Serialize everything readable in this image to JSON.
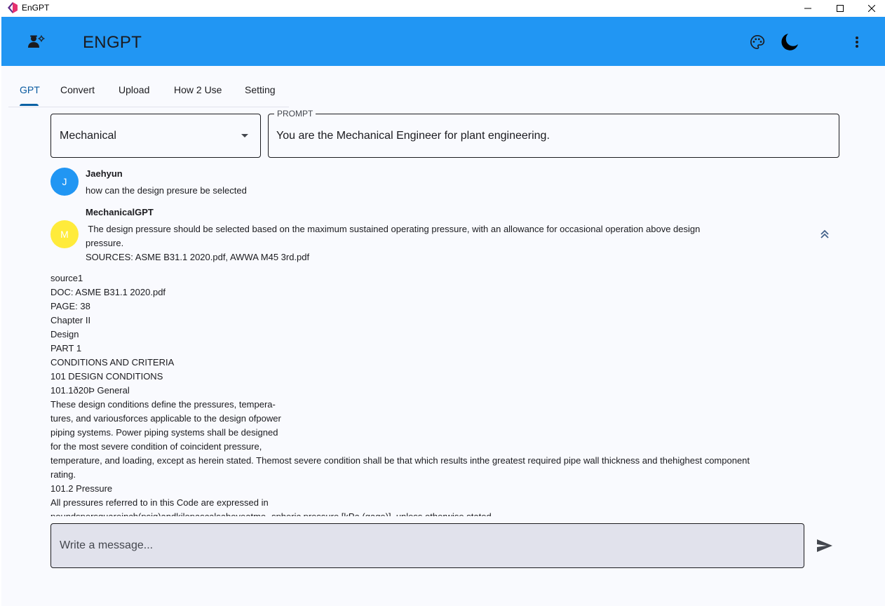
{
  "window": {
    "title": "EnGPT",
    "min_icon": "minimize-icon",
    "max_icon": "maximize-icon",
    "close_icon": "close-icon"
  },
  "appbar": {
    "title": "ENGPT",
    "background": "#2196f3",
    "leading_icon": "engineer-icon",
    "actions": [
      "palette-icon",
      "dark-mode-icon",
      "more-vert-icon"
    ]
  },
  "tabs": [
    {
      "label": "GPT",
      "active": true
    },
    {
      "label": "Convert",
      "active": false
    },
    {
      "label": "Upload",
      "active": false
    },
    {
      "label": "How 2 Use",
      "active": false
    },
    {
      "label": "Setting",
      "active": false
    }
  ],
  "role_select": {
    "value": "Mechanical",
    "icon": "dropdown-arrow-icon"
  },
  "prompt": {
    "label": "PROMPT",
    "value": "You are the Mechanical Engineer for plant engineering."
  },
  "messages": [
    {
      "author": "Jaehyun",
      "avatar_letter": "J",
      "avatar_color": "#2196f3",
      "text": "how can the design presure be selected"
    },
    {
      "author": "MechanicalGPT",
      "avatar_letter": "M",
      "avatar_color": "#ffeb3b",
      "text_line1": " The design pressure should be selected based on the maximum sustained operating pressure, with an allowance for occasional operation above design",
      "text_line2": "pressure.",
      "sources": "SOURCES: ASME B31.1 2020.pdf, AWWA M45 3rd.pdf",
      "collapse_icon": "double-chevron-up-icon"
    }
  ],
  "source_detail": [
    "source1",
    "DOC: ASME B31.1 2020.pdf",
    "PAGE: 38",
    "Chapter II",
    "Design",
    "PART 1",
    "CONDITIONS AND CRITERIA",
    "101 DESIGN CONDITIONS",
    "101.1ð20Þ General",
    "These design conditions define the pressures, tempera-",
    "tures, and variousforces applicable to the design ofpower",
    "piping systems. Power piping systems shall be designed",
    "for the most severe condition of coincident pressure,",
    "temperature, and loading, except as herein stated. Themost severe condition shall be that which results inthe greatest required pipe wall thickness and thehighest component",
    "rating.",
    "101.2 Pressure",
    "All pressures referred to in this Code are expressed in",
    "poundspersquareinch(psig)andkilopascalsaboveatmo- spheric pressure [kPa (gage)], unless otherwise stated"
  ],
  "composer": {
    "placeholder": "Write a message...",
    "send_icon": "send-icon"
  }
}
